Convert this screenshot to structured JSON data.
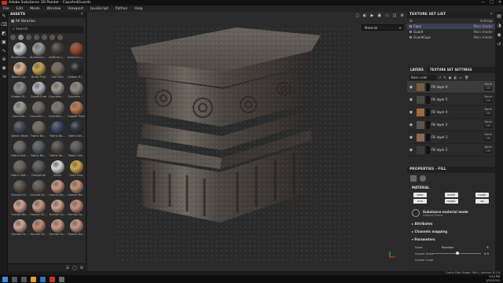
{
  "window": {
    "title": "Adobe Substance 3D Painter - CapsAndGuards",
    "controls": [
      "—",
      "□",
      "✕"
    ]
  },
  "menu": [
    "File",
    "Edit",
    "Mode",
    "Window",
    "Viewport",
    "JavaScript",
    "Python",
    "Help"
  ],
  "assets": {
    "title": "ASSETS",
    "breadcrumb": "All libraries",
    "search_placeholder": "Search",
    "materials": [
      {
        "label": "Aluminum Am...",
        "color": "#cfcfcf"
      },
      {
        "label": "Aluminum Pa...",
        "color": "#9a9a9a"
      },
      {
        "label": "Artificial Lea...",
        "color": "#4a4340"
      },
      {
        "label": "Autumn Leaf",
        "color": "#9b4a2a"
      },
      {
        "label": "Baked Lig...",
        "color": "#e1b38c"
      },
      {
        "label": "Brass Pure",
        "color": "#c9a14a"
      },
      {
        "label": "Calf Skin",
        "color": "#7b6a59"
      },
      {
        "label": "Carbon Fiber",
        "color": "#2a2a2a"
      },
      {
        "label": "Coated Met...",
        "color": "#8d8d8d"
      },
      {
        "label": "Cobalt Pure",
        "color": "#b8b8c4"
      },
      {
        "label": "Concrete B...",
        "color": "#9e978d"
      },
      {
        "label": "Concrete C...",
        "color": "#8e8a84"
      },
      {
        "label": "Concrete...",
        "color": "#a39c92"
      },
      {
        "label": "Concrete S...",
        "color": "#6f6a64"
      },
      {
        "label": "Concrete S...",
        "color": "#7f7a74"
      },
      {
        "label": "Copper Pure",
        "color": "#c47a4e"
      },
      {
        "label": "Denim Rivet",
        "color": "#404a5c"
      },
      {
        "label": "Fabric Ba...",
        "color": "#756c61"
      },
      {
        "label": "Fabric Ba...",
        "color": "#3c4a66"
      },
      {
        "label": "Fabric De...",
        "color": "#2f3644"
      },
      {
        "label": "Fabric Knit...",
        "color": "#6e6660"
      },
      {
        "label": "Fabric Ro...",
        "color": "#5b5e64"
      },
      {
        "label": "Fabric Ro...",
        "color": "#55504c"
      },
      {
        "label": "Fabric Sof...",
        "color": "#605a55"
      },
      {
        "label": "Fabric Soft...",
        "color": "#6a645e"
      },
      {
        "label": "Footprints",
        "color": "#5a5a5a"
      },
      {
        "label": "Gilder",
        "color": "#d8d8d8"
      },
      {
        "label": "Gold Pure",
        "color": "#d1a84a"
      },
      {
        "label": "Ground Gr...",
        "color": "#5c5246"
      },
      {
        "label": "Ground Gr...",
        "color": "#645a4f"
      },
      {
        "label": "Human Ba...",
        "color": "#d19a82"
      },
      {
        "label": "Human Be...",
        "color": "#c88f77"
      },
      {
        "label": "Human Bo...",
        "color": "#d6a18a"
      },
      {
        "label": "Human Ch...",
        "color": "#c99884"
      },
      {
        "label": "Human Ey...",
        "color": "#d2a08c"
      },
      {
        "label": "Human Fa...",
        "color": "#cc927a"
      },
      {
        "label": "Human Fe...",
        "color": "#d4a592"
      },
      {
        "label": "Human Fo...",
        "color": "#c68d75"
      },
      {
        "label": "Human Fo...",
        "color": "#d09c86"
      },
      {
        "label": "Human Ha...",
        "color": "#cb9680"
      }
    ]
  },
  "viewport": {
    "channel": "Material"
  },
  "texture_sets": {
    "title": "TEXTURE SET LIST",
    "settings_label": "Settings",
    "items": [
      {
        "name": "Caps",
        "shader": "Main shader",
        "selected": true
      },
      {
        "name": "Guard",
        "shader": "Main shader",
        "selected": false
      },
      {
        "name": "GuardCaps",
        "shader": "Main shader",
        "selected": false
      }
    ]
  },
  "layers_panel": {
    "tab_layers": "LAYERS",
    "tab_settings": "TEXTURE SET SETTINGS",
    "blend_mode": "Base color",
    "items": [
      {
        "name": "Fill layer 6",
        "blend": "Norm",
        "opacity": "100",
        "thumb": "#7a5a3d",
        "selected": true
      },
      {
        "name": "Fill layer 5",
        "blend": "Norm",
        "opacity": "100",
        "thumb": "#4b4744",
        "selected": false
      },
      {
        "name": "Fill layer 4",
        "blend": "Norm",
        "opacity": "100",
        "thumb": "#a06a3a",
        "selected": false
      },
      {
        "name": "Fill layer 3",
        "blend": "Norm",
        "opacity": "100",
        "thumb": "#5d524a",
        "selected": false
      },
      {
        "name": "Fill layer 1",
        "blend": "Norm",
        "opacity": "100",
        "thumb": "#8a6a55",
        "selected": false
      },
      {
        "name": "Fill layer 2",
        "blend": "Norm",
        "opacity": "100",
        "thumb": "#3e3a38",
        "selected": false
      }
    ]
  },
  "properties": {
    "title": "PROPERTIES - FILL",
    "material_label": "MATERIAL",
    "channels_row1": [
      "color",
      "metal",
      "rough"
    ],
    "channels_row2": [
      "nrm",
      "height",
      "ao"
    ],
    "substance_title": "Substance material mode",
    "substance_name": "Ground Gravel",
    "sections": [
      "Attributes",
      "Channels mapping",
      "Parameters"
    ],
    "params": [
      {
        "name": "Seed",
        "value": "Random"
      },
      {
        "name": "Gravel Scale",
        "value": "0.5",
        "fraction": 0.5
      },
      {
        "name": "Gravel Color",
        "value": ""
      }
    ]
  },
  "status": {
    "text": "Cache Disk Usage: 96% | Version: 8.1.0"
  },
  "taskbar": {
    "time": "3:24 PM",
    "date": "1/22/2023"
  }
}
